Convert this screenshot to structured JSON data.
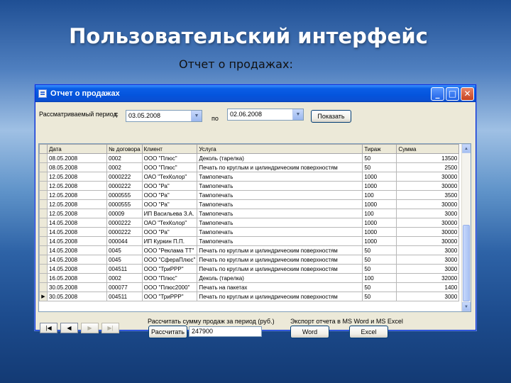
{
  "slide": {
    "title": "Пользовательский интерфейс",
    "subtitle": "Отчет о продажах:"
  },
  "window": {
    "title": "Отчет о продажах",
    "controls": {
      "minimize": "_",
      "maximize": "□",
      "close": "✕"
    }
  },
  "filter": {
    "period_label": "Рассматриваемый период",
    "from_label": "с",
    "from_value": "03.05.2008",
    "to_label": "по",
    "to_value": "02.06.2008",
    "show_button": "Показать"
  },
  "table": {
    "columns": [
      "Дата",
      "№ договора",
      "Клиент",
      "Услуга",
      "Тираж",
      "Сумма"
    ],
    "rows": [
      [
        "08.05.2008",
        "0002",
        "ООО \"Плюс\"",
        "Деколь (тарелка)",
        "50",
        "13500"
      ],
      [
        "08.05.2008",
        "0002",
        "ООО \"Плюс\"",
        "Печать по круглым и цилиндрическим поверхностям",
        "50",
        "2500"
      ],
      [
        "12.05.2008",
        "0000222",
        "ОАО \"ТехКолор\"",
        "Тампопечать",
        "1000",
        "30000"
      ],
      [
        "12.05.2008",
        "0000222",
        "ООО \"Ра\"",
        "Тампопечать",
        "1000",
        "30000"
      ],
      [
        "12.05.2008",
        "0000555",
        "ООО \"Ра\"",
        "Тампопечать",
        "100",
        "3500"
      ],
      [
        "12.05.2008",
        "0000555",
        "ООО \"Ра\"",
        "Тампопечать",
        "1000",
        "30000"
      ],
      [
        "12.05.2008",
        "00009",
        "ИП Васильева З.А.",
        "Тампопечать",
        "100",
        "3000"
      ],
      [
        "14.05.2008",
        "0000222",
        "ОАО \"ТехКолор\"",
        "Тампопечать",
        "1000",
        "30000"
      ],
      [
        "14.05.2008",
        "0000222",
        "ООО \"Ра\"",
        "Тампопечать",
        "1000",
        "30000"
      ],
      [
        "14.05.2008",
        "000044",
        "ИП Куркин П.П.",
        "Тампопечать",
        "1000",
        "30000"
      ],
      [
        "14.05.2008",
        "0045",
        "ООО \"Реклама ТТ\"",
        "Печать по круглым и цилиндрическим поверхностям",
        "50",
        "3000"
      ],
      [
        "14.05.2008",
        "0045",
        "ООО \"СфераПлюс\"",
        "Печать по круглым и цилиндрическим поверхностям",
        "50",
        "3000"
      ],
      [
        "14.05.2008",
        "004511",
        "ООО \"ТриРРР\"",
        "Печать по круглым и цилиндрическим поверхностям",
        "50",
        "3000"
      ],
      [
        "16.05.2008",
        "0002",
        "ООО \"Плюс\"",
        "Деколь (тарелка)",
        "100",
        "32000"
      ],
      [
        "30.05.2008",
        "000077",
        "ООО \"Плюс2000\"",
        "Печать на пакетах",
        "50",
        "1400"
      ],
      [
        "30.05.2008",
        "004511",
        "ООО \"ТриРРР\"",
        "Печать по круглым и цилиндрическим поверхностям",
        "50",
        "3000"
      ]
    ],
    "current_row_marker": "▶"
  },
  "navigation": {
    "first": "|◀",
    "prev": "◀",
    "next": "▶",
    "last": "▶|"
  },
  "summary": {
    "label": "Рассчитать сумму продаж за период (руб.)",
    "button": "Рассчитать",
    "value": "247900"
  },
  "export": {
    "label": "Экспорт отчета в MS Word и MS Excel",
    "word_button": "Word",
    "excel_button": "Excel"
  }
}
